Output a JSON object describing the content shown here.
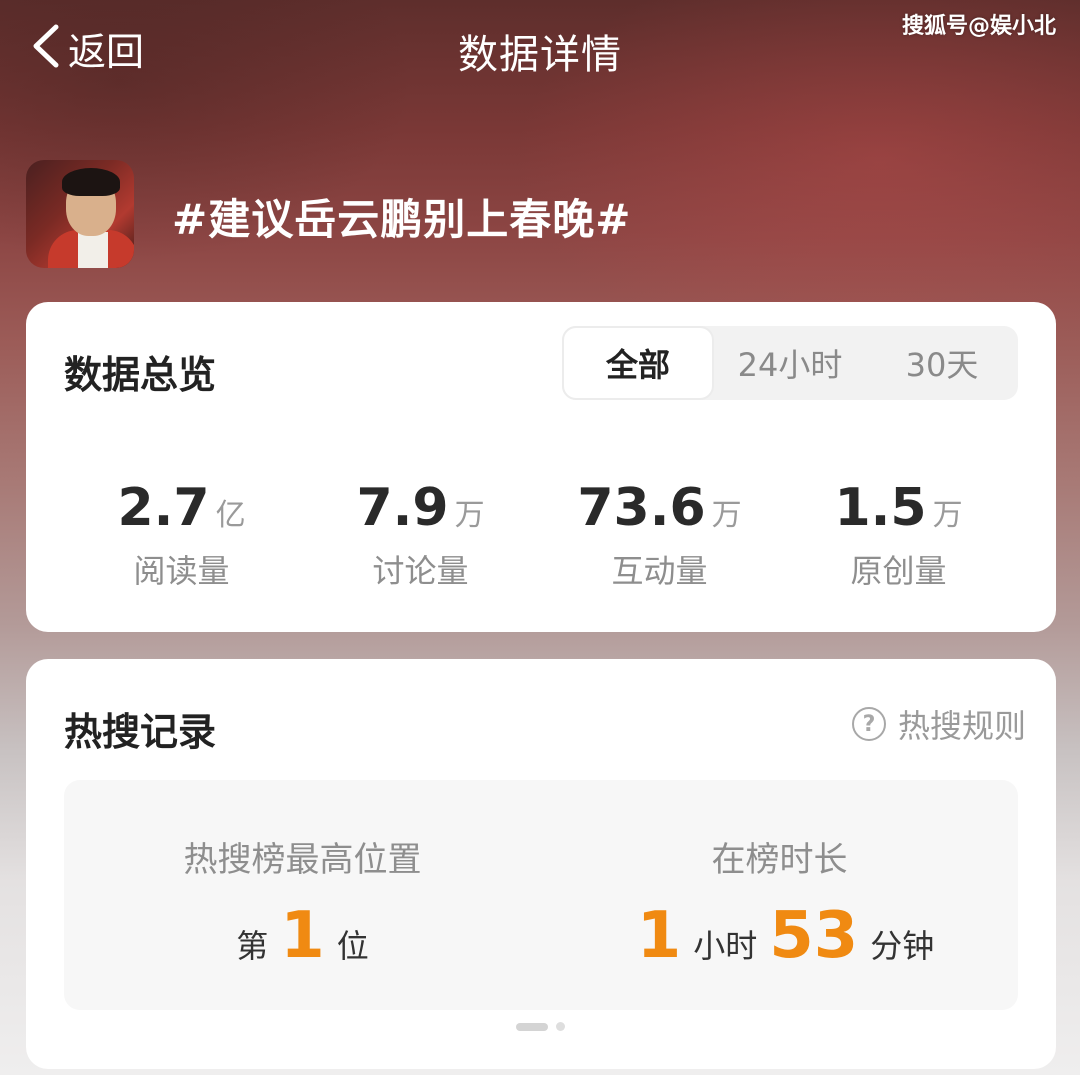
{
  "header": {
    "back_label": "返回",
    "title": "数据详情",
    "watermark": "搜狐号@娱小北"
  },
  "topic": {
    "title": "#建议岳云鹏别上春晚#"
  },
  "overview": {
    "heading": "数据总览",
    "tabs": [
      "全部",
      "24小时",
      "30天"
    ],
    "active_tab": "全部",
    "stats": [
      {
        "value": "2.7",
        "unit": "亿",
        "label": "阅读量"
      },
      {
        "value": "7.9",
        "unit": "万",
        "label": "讨论量"
      },
      {
        "value": "73.6",
        "unit": "万",
        "label": "互动量"
      },
      {
        "value": "1.5",
        "unit": "万",
        "label": "原创量"
      }
    ]
  },
  "hot_search": {
    "heading": "热搜记录",
    "rules_label": "热搜规则",
    "peak": {
      "label": "热搜榜最高位置",
      "prefix": "第",
      "rank": "1",
      "suffix": "位"
    },
    "duration": {
      "label": "在榜时长",
      "hours": "1",
      "hours_unit": "小时",
      "minutes": "53",
      "minutes_unit": "分钟"
    }
  },
  "colors": {
    "accent": "#f08a12",
    "card_bg": "#ffffff"
  }
}
